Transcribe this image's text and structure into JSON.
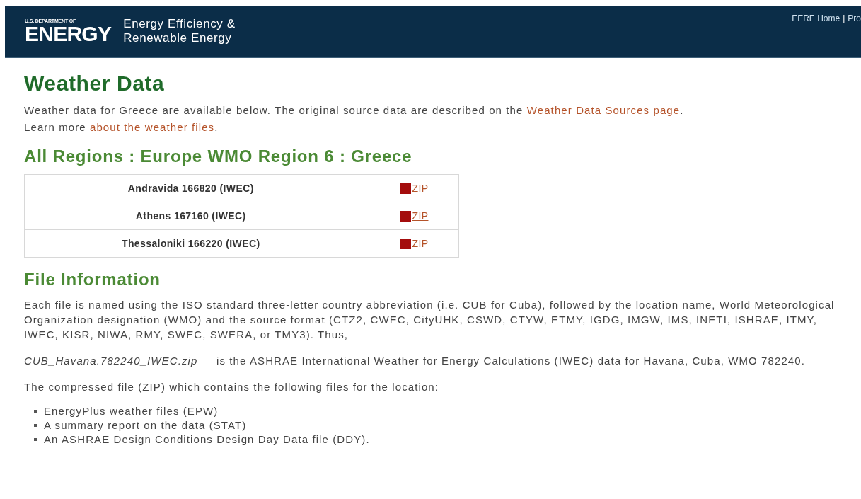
{
  "header": {
    "agency_small": "U.S. DEPARTMENT OF",
    "agency_large": "ENERGY",
    "office_lines": [
      "Energy Efficiency &",
      "Renewable Energy"
    ],
    "top_links": [
      {
        "label": "EERE Home"
      },
      {
        "label": "|",
        "kind": "separator"
      },
      {
        "label": "Pro"
      }
    ]
  },
  "title": "Weather Data",
  "intro": [
    {
      "before": "Weather data for Greece are available below. The original source data are described on the ",
      "link": "Weather Data Sources page",
      "after": "."
    },
    {
      "before": "Learn more ",
      "link": "about the weather files",
      "after": "."
    }
  ],
  "breadcrumb_heading": "All Regions : Europe WMO Region 6 : Greece",
  "stations": [
    {
      "name": "Andravida 166820 (IWEC)",
      "download": "ZIP"
    },
    {
      "name": "Athens 167160 (IWEC)",
      "download": "ZIP"
    },
    {
      "name": "Thessaloniki 166220 (IWEC)",
      "download": "ZIP"
    }
  ],
  "file_info": {
    "heading": "File Information",
    "paragraphs": [
      "Each file is named using the ISO standard three-letter country abbreviation (i.e. CUB for Cuba), followed by the location name, World Meteorological Organization designation (WMO) and the source format (CTZ2, CWEC, CityUHK, CSWD, CTYW, ETMY, IGDG, IMGW, IMS, INETI, ISHRAE, ITMY, IWEC, KISR, NIWA, RMY, SWEC, SWERA, or TMY3). Thus,",
      "*CUB_Havana.782240_IWEC.zip* — is the ASHRAE International Weather for Energy Calculations (IWEC) data for Havana, Cuba, WMO 782240.",
      "The compressed file (ZIP) which contains the following files for the location:"
    ],
    "bullets": [
      "EnergyPlus weather files (EPW)",
      "A summary report on the data (STAT)",
      "An ASHRAE Design Conditions Design Day Data file (DDY)."
    ]
  }
}
